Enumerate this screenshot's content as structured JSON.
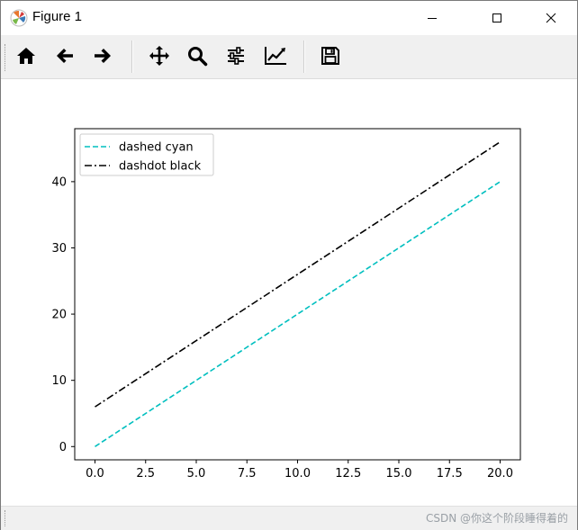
{
  "window": {
    "title": "Figure 1",
    "icons": [
      "matplotlib-logo-icon",
      "minimize-icon",
      "maximize-icon",
      "close-icon"
    ]
  },
  "toolbar": {
    "items": [
      {
        "name": "home",
        "icon": "home-icon"
      },
      {
        "name": "back",
        "icon": "arrow-left-icon"
      },
      {
        "name": "forward",
        "icon": "arrow-right-icon"
      },
      {
        "name": "pan",
        "icon": "move-icon"
      },
      {
        "name": "zoom",
        "icon": "zoom-icon"
      },
      {
        "name": "subplots",
        "icon": "sliders-icon"
      },
      {
        "name": "customize",
        "icon": "chart-edit-icon"
      },
      {
        "name": "save",
        "icon": "save-icon"
      }
    ]
  },
  "statusbar": {
    "watermark": "CSDN @你这个阶段睡得着的"
  },
  "chart_data": {
    "type": "line",
    "title": "",
    "xlabel": "",
    "ylabel": "",
    "xlim": [
      -1,
      21
    ],
    "ylim": [
      -2,
      48
    ],
    "x_ticks": [
      0,
      2.5,
      5,
      7.5,
      10,
      12.5,
      15,
      17.5,
      20
    ],
    "x_tick_labels": [
      "0.0",
      "2.5",
      "5.0",
      "7.5",
      "10.0",
      "12.5",
      "15.0",
      "17.5",
      "20.0"
    ],
    "y_ticks": [
      0,
      10,
      20,
      30,
      40
    ],
    "y_tick_labels": [
      "0",
      "10",
      "20",
      "30",
      "40"
    ],
    "grid": false,
    "legend_position": "upper-left",
    "series": [
      {
        "name": "dashed cyan",
        "color": "#00bfbf",
        "linestyle": "dashed",
        "x": [
          0,
          20
        ],
        "y": [
          0,
          40
        ]
      },
      {
        "name": "dashdot black",
        "color": "#000000",
        "linestyle": "dashdot",
        "x": [
          0,
          20
        ],
        "y": [
          6,
          46
        ]
      }
    ]
  }
}
